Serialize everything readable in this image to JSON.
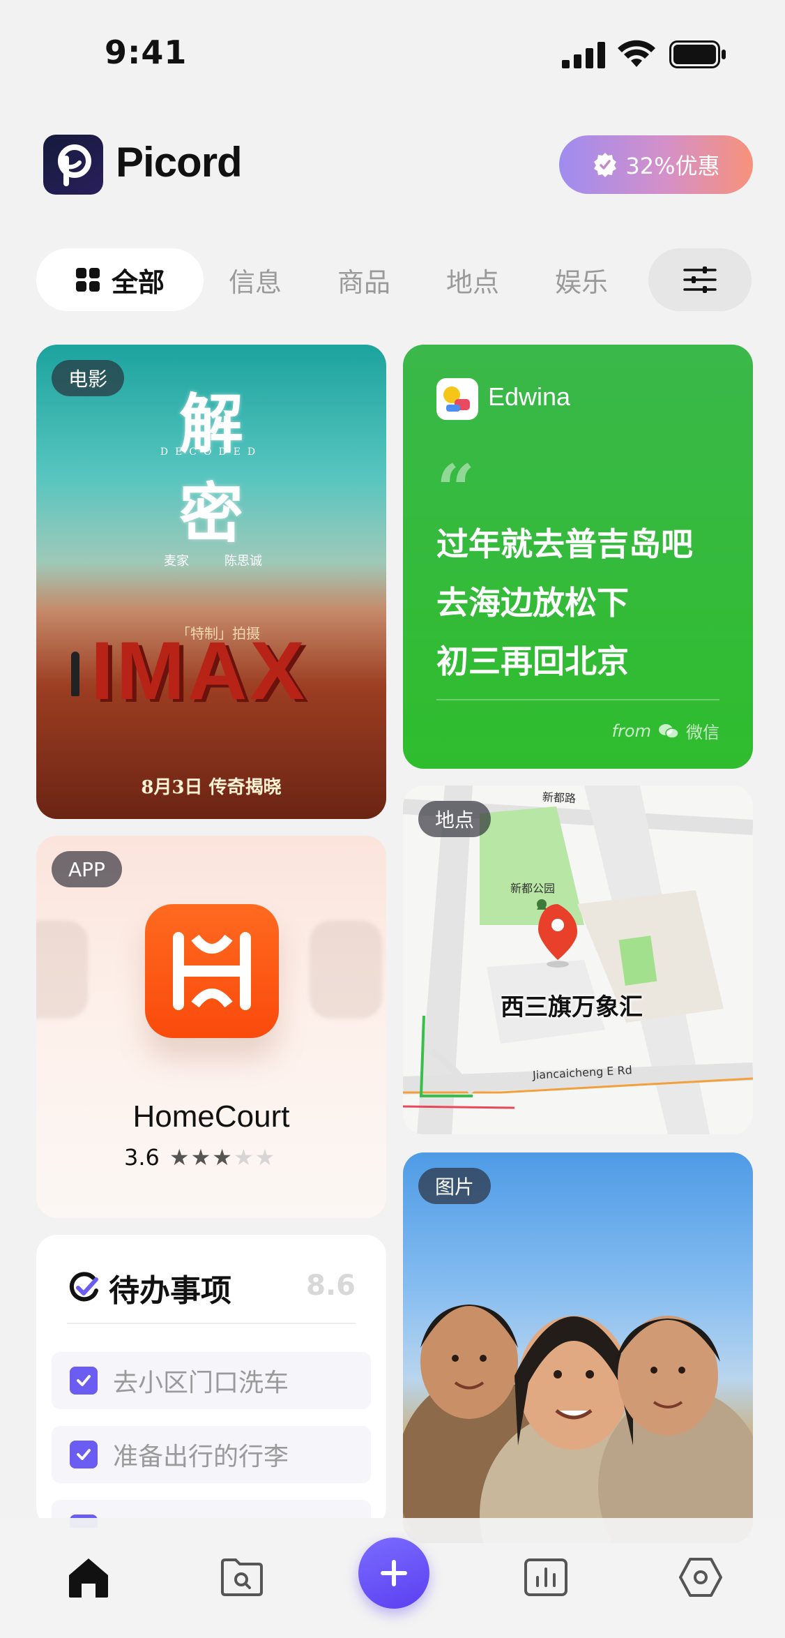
{
  "status_bar": {
    "time": "9:41"
  },
  "header": {
    "app_name": "Picord",
    "promo_label": "32%优惠"
  },
  "tabs": {
    "all": "全部",
    "items": [
      "信息",
      "商品",
      "地点",
      "娱乐"
    ]
  },
  "cards": {
    "movie": {
      "tag": "电影",
      "title_line1": "解",
      "title_line2": "密",
      "title_en": "DECODED",
      "cast_1": "麦家",
      "cast_2": "陈思诚",
      "format_note": "「特制」拍摄",
      "imax": "IMAX",
      "release": "8月3日 传奇揭晓"
    },
    "message": {
      "sender": "Edwina",
      "lines": [
        "过年就去普吉岛吧",
        "去海边放松下",
        "初三再回北京"
      ],
      "from_word": "from",
      "source": "微信"
    },
    "map": {
      "tag": "地点",
      "place_name": "西三旗万象汇",
      "park_name": "新都公园",
      "road_top": "新都路",
      "road_bottom": "Jiancaicheng E Rd"
    },
    "app": {
      "tag": "APP",
      "name": "HomeCourt",
      "rating": "3.6",
      "stars_filled": 3,
      "stars_total": 5
    },
    "todo": {
      "title": "待办事项",
      "score": "8.6",
      "items": [
        "去小区门口洗车",
        "准备出行的行李"
      ]
    },
    "photo": {
      "tag": "图片"
    }
  },
  "colors": {
    "accent": "#6b5cf2",
    "message_green": "#2fbd2e",
    "app_orange": "#fa4a0c",
    "map_pin": "#e8402a"
  }
}
